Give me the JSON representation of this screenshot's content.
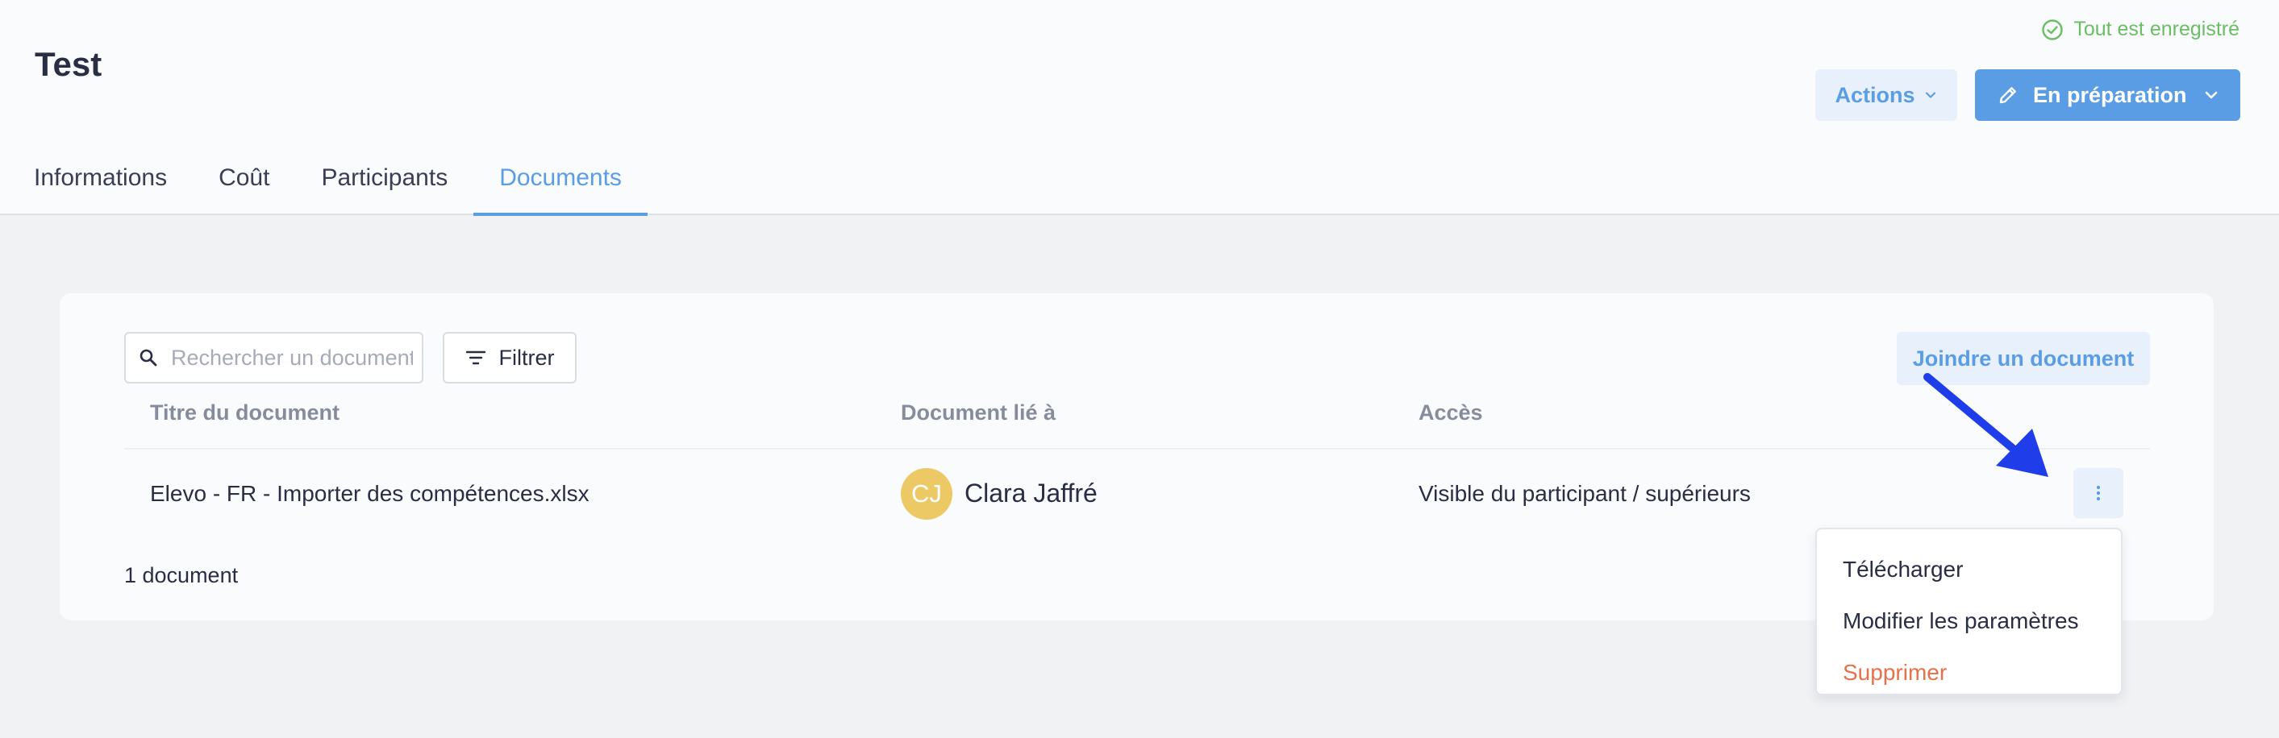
{
  "header": {
    "title": "Test",
    "save_status": "Tout est enregistré",
    "actions_label": "Actions",
    "status_label": "En préparation"
  },
  "tabs": [
    {
      "label": "Informations",
      "active": false
    },
    {
      "label": "Coût",
      "active": false
    },
    {
      "label": "Participants",
      "active": false
    },
    {
      "label": "Documents",
      "active": true
    }
  ],
  "toolbar": {
    "search_placeholder": "Rechercher un document",
    "filter_label": "Filtrer",
    "attach_label": "Joindre un document"
  },
  "table": {
    "columns": [
      "Titre du document",
      "Document lié à",
      "Accès"
    ],
    "rows": [
      {
        "title": "Elevo - FR - Importer des compétences.xlsx",
        "linked_to": {
          "initials": "CJ",
          "name": "Clara Jaffré",
          "avatar_color": "#edc965"
        },
        "access": "Visible du participant / supérieurs"
      }
    ],
    "count_label": "1 document"
  },
  "row_menu": {
    "items": [
      {
        "label": "Télécharger",
        "danger": false
      },
      {
        "label": "Modifier les paramètres",
        "danger": false
      },
      {
        "label": "Supprimer",
        "danger": true
      }
    ]
  },
  "colors": {
    "accent": "#5b9de4",
    "success": "#6abe64",
    "danger": "#e8714a",
    "annotation_arrow": "#1f3de8"
  },
  "icons": {
    "save_status": "check-circle-icon",
    "actions_caret": "chevron-down-icon",
    "status_edit": "pencil-icon",
    "status_caret": "chevron-down-icon",
    "search": "search-icon",
    "filter": "filter-icon",
    "row_more": "more-vertical-icon"
  }
}
